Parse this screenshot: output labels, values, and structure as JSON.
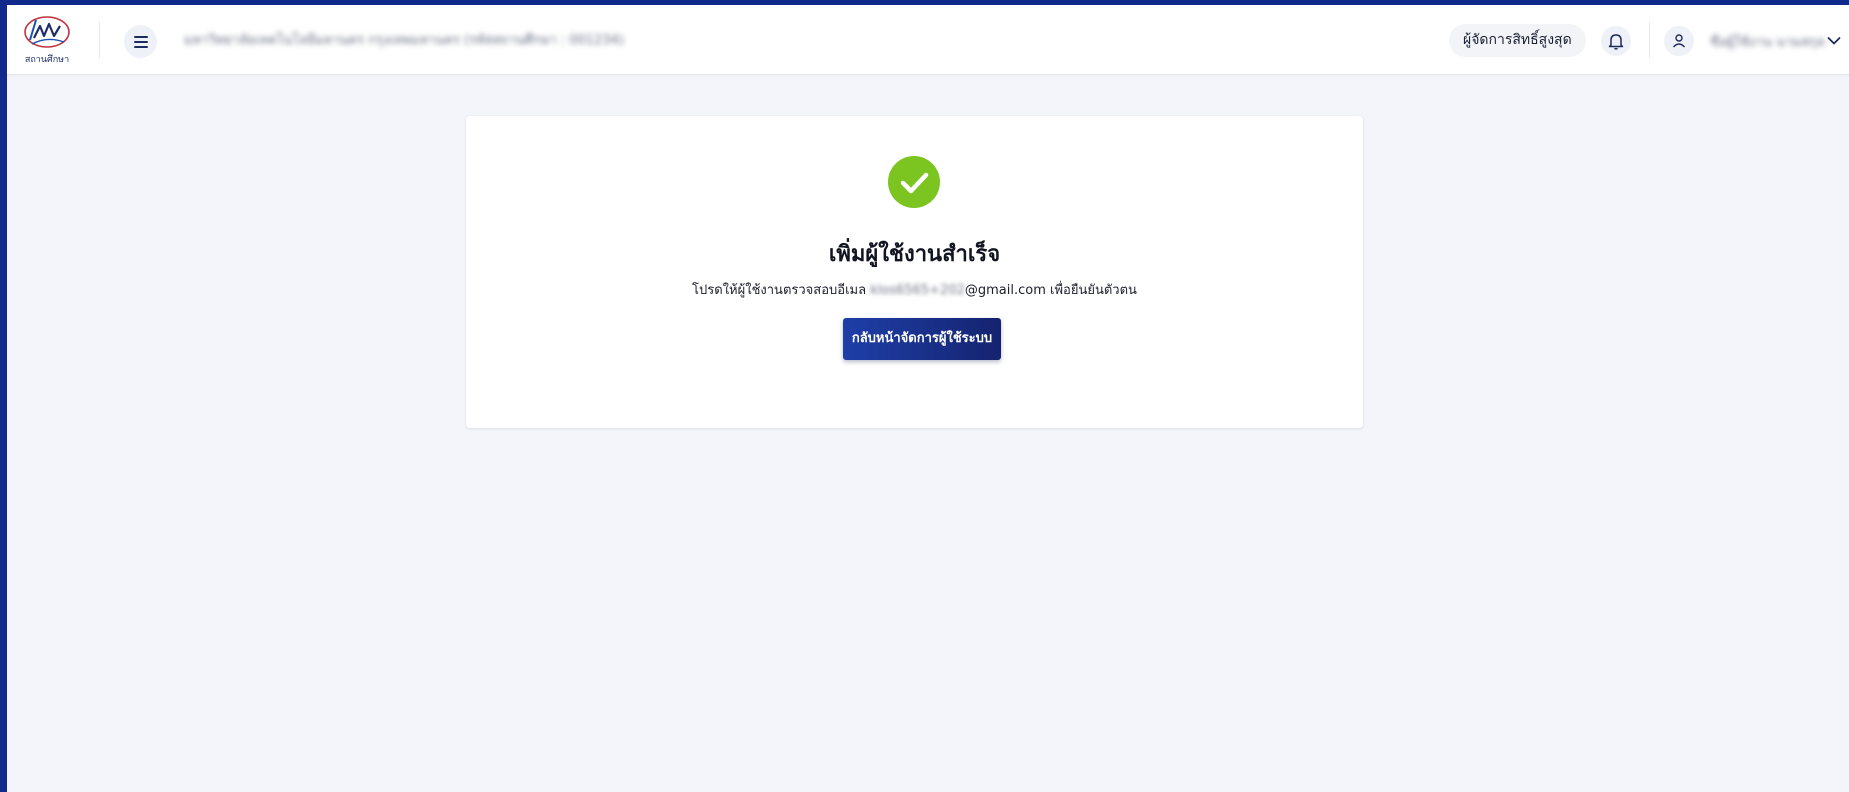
{
  "header": {
    "logo_text": "สถานศึกษา",
    "school_name": "มหาวิทยาลัยเทคโนโลยีมหานคร กรุงเทพมหานคร (รหัสสถานศึกษา : 001234)",
    "role": "ผู้จัดการสิทธิ์สูงสุด",
    "user_name": "ชื่อผู้ใช้งาน นามสกุล"
  },
  "success": {
    "title": "เพิ่มผู้ใช้งานสำเร็จ",
    "desc_prefix": "โปรดให้ผู้ใช้งานตรวจสอบอีเมล",
    "email_hidden": "klos6565+202",
    "email_domain": "@gmail.com",
    "desc_suffix": " เพื่อยืนยันตัวตน",
    "button_label": "กลับหน้าจัดการผู้ใช้ระบบ"
  },
  "colors": {
    "success_green": "#7cc420",
    "primary_button": "#1e3fa8",
    "frame_background": "#0f2a8a"
  },
  "icons": {
    "menu": "hamburger-menu",
    "bell": "notification-bell",
    "user": "user-avatar",
    "chevron": "chevron-down",
    "success": "check-circle"
  }
}
